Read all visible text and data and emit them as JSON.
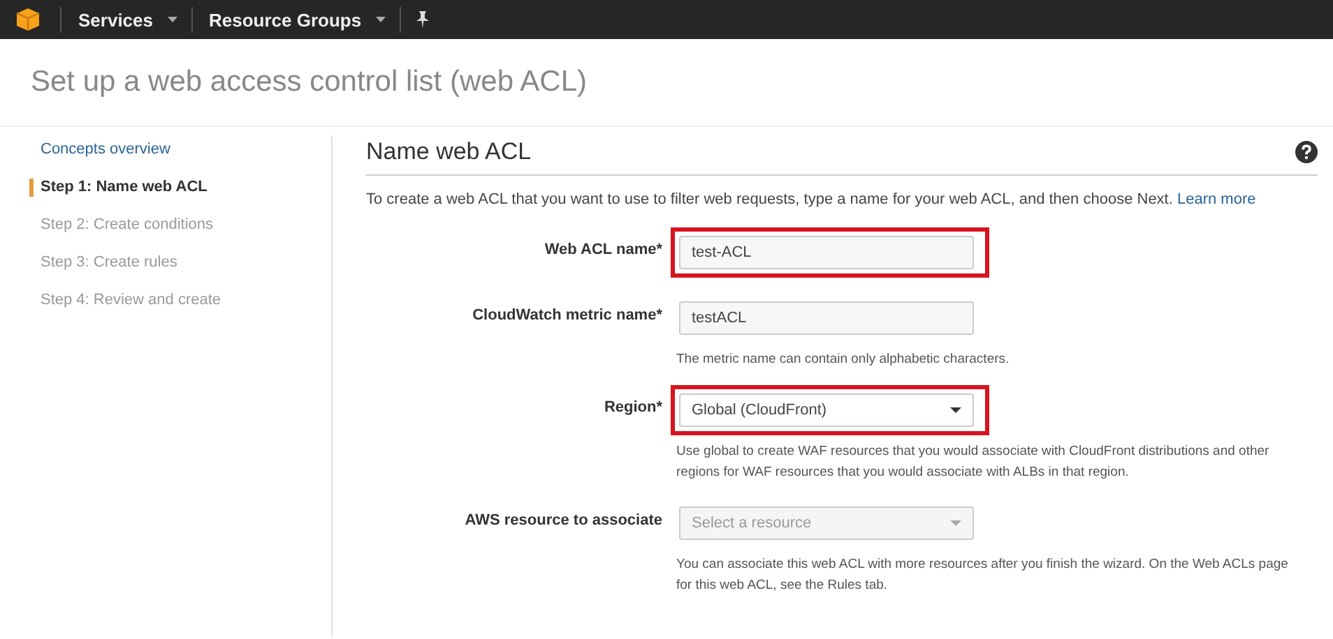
{
  "top_nav": {
    "items": [
      {
        "label": "Services"
      },
      {
        "label": "Resource Groups"
      }
    ]
  },
  "page_title": "Set up a web access control list (web ACL)",
  "sidebar": {
    "items": [
      {
        "label": "Concepts overview",
        "kind": "link",
        "selected": false
      },
      {
        "label": "Step 1: Name web ACL",
        "kind": "step",
        "selected": true
      },
      {
        "label": "Step 2: Create conditions",
        "kind": "step",
        "selected": false
      },
      {
        "label": "Step 3: Create rules",
        "kind": "step",
        "selected": false
      },
      {
        "label": "Step 4: Review and create",
        "kind": "step",
        "selected": false
      }
    ]
  },
  "section": {
    "title": "Name web ACL",
    "intro": "To create a web ACL that you want to use to filter web requests, type a name for your web ACL, and then choose Next.",
    "intro_link": "Learn more"
  },
  "fields": [
    {
      "label": "Web ACL name*",
      "kind": "text",
      "value": "test-ACL",
      "highlighted": true,
      "disabled": false
    },
    {
      "label": "CloudWatch metric name*",
      "kind": "text",
      "value": "testACL",
      "highlighted": false,
      "disabled": false,
      "hint": "The metric name can contain only alphabetic characters."
    },
    {
      "label": "Region*",
      "kind": "select",
      "value": "Global (CloudFront)",
      "highlighted": true,
      "disabled": false,
      "hint": "Use global to create WAF resources that you would associate with CloudFront distributions and other regions for WAF resources that you would associate with ALBs in that region."
    },
    {
      "label": "AWS resource to associate",
      "kind": "select",
      "placeholder": "Select a resource",
      "highlighted": false,
      "disabled": true,
      "hint": "You can associate this web ACL with more resources after you finish the wizard. On the Web ACLs page for this web ACL, see the Rules tab."
    }
  ]
}
